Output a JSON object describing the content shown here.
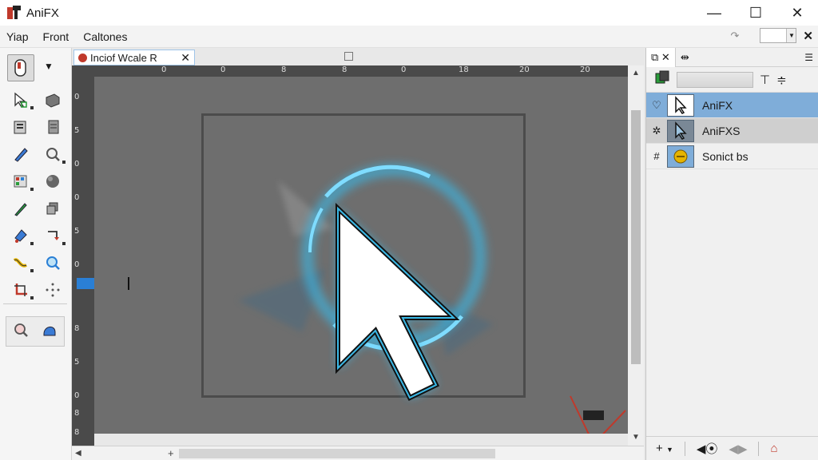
{
  "app": {
    "title": "AniFX"
  },
  "window_controls": {
    "minimize": "—",
    "maximize": "☐",
    "close": "✕"
  },
  "menu": {
    "items": [
      "Yiap",
      "Front",
      "Caltones"
    ]
  },
  "document": {
    "tab_label": "Inciof Wcale R"
  },
  "ruler": {
    "top_labels": [
      "0",
      "0",
      "8",
      "8",
      "0",
      "18",
      "20",
      "20"
    ],
    "left_labels": [
      "0",
      "5",
      "0",
      "0",
      "5",
      "0",
      "8",
      "5",
      "0",
      "8",
      "8"
    ]
  },
  "layers": {
    "items": [
      {
        "name": "AniFX",
        "vis_icon": "heart-outline-icon",
        "thumb": "cursor-icon"
      },
      {
        "name": "AniFXS",
        "vis_icon": "gear-icon",
        "thumb": "cursor-icon"
      },
      {
        "name": "Sonict bs",
        "vis_icon": "hash-icon",
        "thumb": "coin-icon"
      }
    ]
  },
  "colors": {
    "accent": "#3ab8e6",
    "layer_selected": "#7fadd9"
  }
}
